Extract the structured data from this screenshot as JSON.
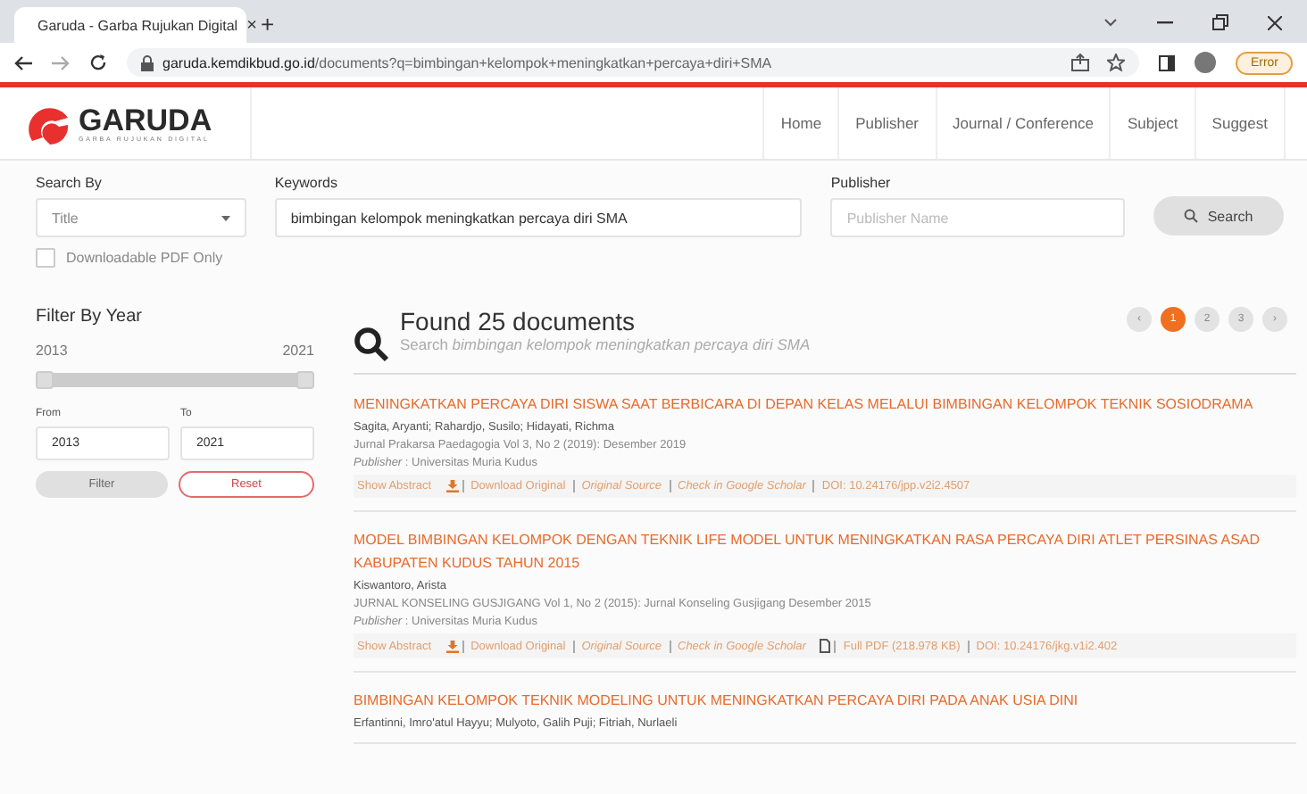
{
  "browser": {
    "tab_title": "Garuda - Garba Rujukan Digital",
    "tab_close": "×",
    "new_tab": "+",
    "address_host": "garuda.kemdikbud.go.id",
    "address_path": "/documents?q=bimbingan+kelompok+meningkatkan+percaya+diri+SMA",
    "error_button": "Error"
  },
  "header": {
    "logo": "GARUDA",
    "logo_tagline": "GARBA RUJUKAN DIGITAL",
    "nav": [
      {
        "label": "Home"
      },
      {
        "label": "Publisher"
      },
      {
        "label": "Journal / Conference"
      },
      {
        "label": "Subject"
      },
      {
        "label": "Suggest"
      }
    ]
  },
  "search": {
    "search_by_label": "Search By",
    "search_by_value": "Title",
    "keywords_label": "Keywords",
    "keywords_value": "bimbingan kelompok meningkatkan percaya diri SMA",
    "publisher_label": "Publisher",
    "publisher_placeholder": "Publisher Name",
    "search_button": "Search",
    "pdf_only": {
      "label": "Downloadable PDF Only",
      "checked": false
    }
  },
  "filter": {
    "title": "Filter By Year",
    "min": "2013",
    "max": "2021",
    "thumbs": [
      {
        "level": 0
      },
      {
        "level": 1
      }
    ],
    "from_label": "From",
    "to_label": "To",
    "from_value": "2013",
    "to_value": "2021",
    "filter_button": "Filter",
    "reset_button": "Reset"
  },
  "results_header": {
    "title": "Found 25 documents",
    "subtitle": "Search *bimbingan kelompok meningkatkan percaya diri SMA*"
  },
  "pagination": [
    {
      "label": "‹",
      "selected": false
    },
    {
      "label": "1",
      "selected": true
    },
    {
      "label": "2",
      "selected": false
    },
    {
      "label": "3",
      "selected": false
    },
    {
      "label": "›",
      "selected": false
    }
  ],
  "results": [
    {
      "title": "MENINGKATKAN PERCAYA DIRI SISWA SAAT BERBICARA DI DEPAN KELAS MELALUI BIMBINGAN KELOMPOK TEKNIK SOSIODRAMA",
      "authors": "Sagita, Aryanti; Rahardjo, Susilo; Hidayati, Richma",
      "journal": "Jurnal Prakarsa Paedagogia Vol 3, No 2 (2019): Desember 2019",
      "publisher": "*Publisher* : Universitas Muria Kudus",
      "links": [
        {
          "kind": "plain",
          "text": "Show Abstract"
        },
        {
          "kind": "download",
          "text": "Download Original"
        },
        {
          "kind": "italic",
          "text": "Original Source"
        },
        {
          "kind": "italic",
          "text": "Check in Google Scholar"
        },
        {
          "kind": "plain",
          "text": "DOI: 10.24176/jpp.v2i2.4507"
        }
      ]
    },
    {
      "title": "MODEL BIMBINGAN KELOMPOK DENGAN TEKNIK LIFE MODEL UNTUK MENINGKATKAN RASA PERCAYA DIRI ATLET PERSINAS ASAD KABUPATEN KUDUS TAHUN 2015",
      "authors": "Kiswantoro, Arista",
      "journal": "JURNAL KONSELING GUSJIGANG Vol 1, No 2 (2015): Jurnal Konseling Gusjigang Desember 2015",
      "publisher": "*Publisher* : Universitas Muria Kudus",
      "links": [
        {
          "kind": "plain",
          "text": "Show Abstract"
        },
        {
          "kind": "download",
          "text": "Download Original"
        },
        {
          "kind": "italic",
          "text": "Original Source"
        },
        {
          "kind": "italic",
          "text": "Check in Google Scholar"
        },
        {
          "kind": "pdf",
          "text": "Full PDF (218.978 KB)"
        },
        {
          "kind": "plain",
          "text": "DOI: 10.24176/jkg.v1i2.402"
        }
      ]
    },
    {
      "title": "BIMBINGAN KELOMPOK TEKNIK MODELING UNTUK MENINGKATKAN PERCAYA DIRI PADA ANAK USIA DINI",
      "authors": "Erfantinni, Imro'atul Hayyu; Mulyoto, Galih Puji; Fitriah, Nurlaeli"
    }
  ]
}
